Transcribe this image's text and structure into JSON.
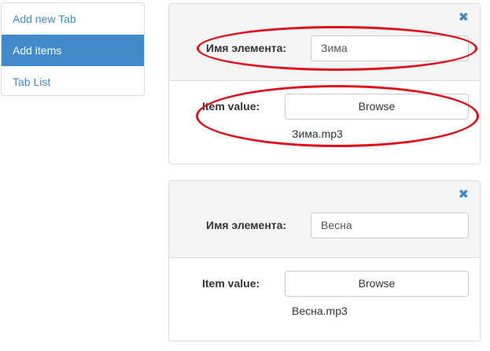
{
  "sidebar": {
    "items": [
      {
        "label": "Add new Tab",
        "active": false
      },
      {
        "label": "Add items",
        "active": true
      },
      {
        "label": "Tab List",
        "active": false
      }
    ]
  },
  "panels": [
    {
      "close_icon": "✖",
      "name_label": "Имя элемента:",
      "name_value": "Зима",
      "value_label": "Item value:",
      "browse_label": "Browse",
      "file_name": "Зима.mp3"
    },
    {
      "close_icon": "✖",
      "name_label": "Имя элемента:",
      "name_value": "Весна",
      "value_label": "Item value:",
      "browse_label": "Browse",
      "file_name": "Весна.mp3"
    }
  ],
  "colors": {
    "accent": "#428bca",
    "annotation": "#e0101a",
    "panel_header_bg": "#f5f5f5",
    "border": "#dddddd"
  }
}
